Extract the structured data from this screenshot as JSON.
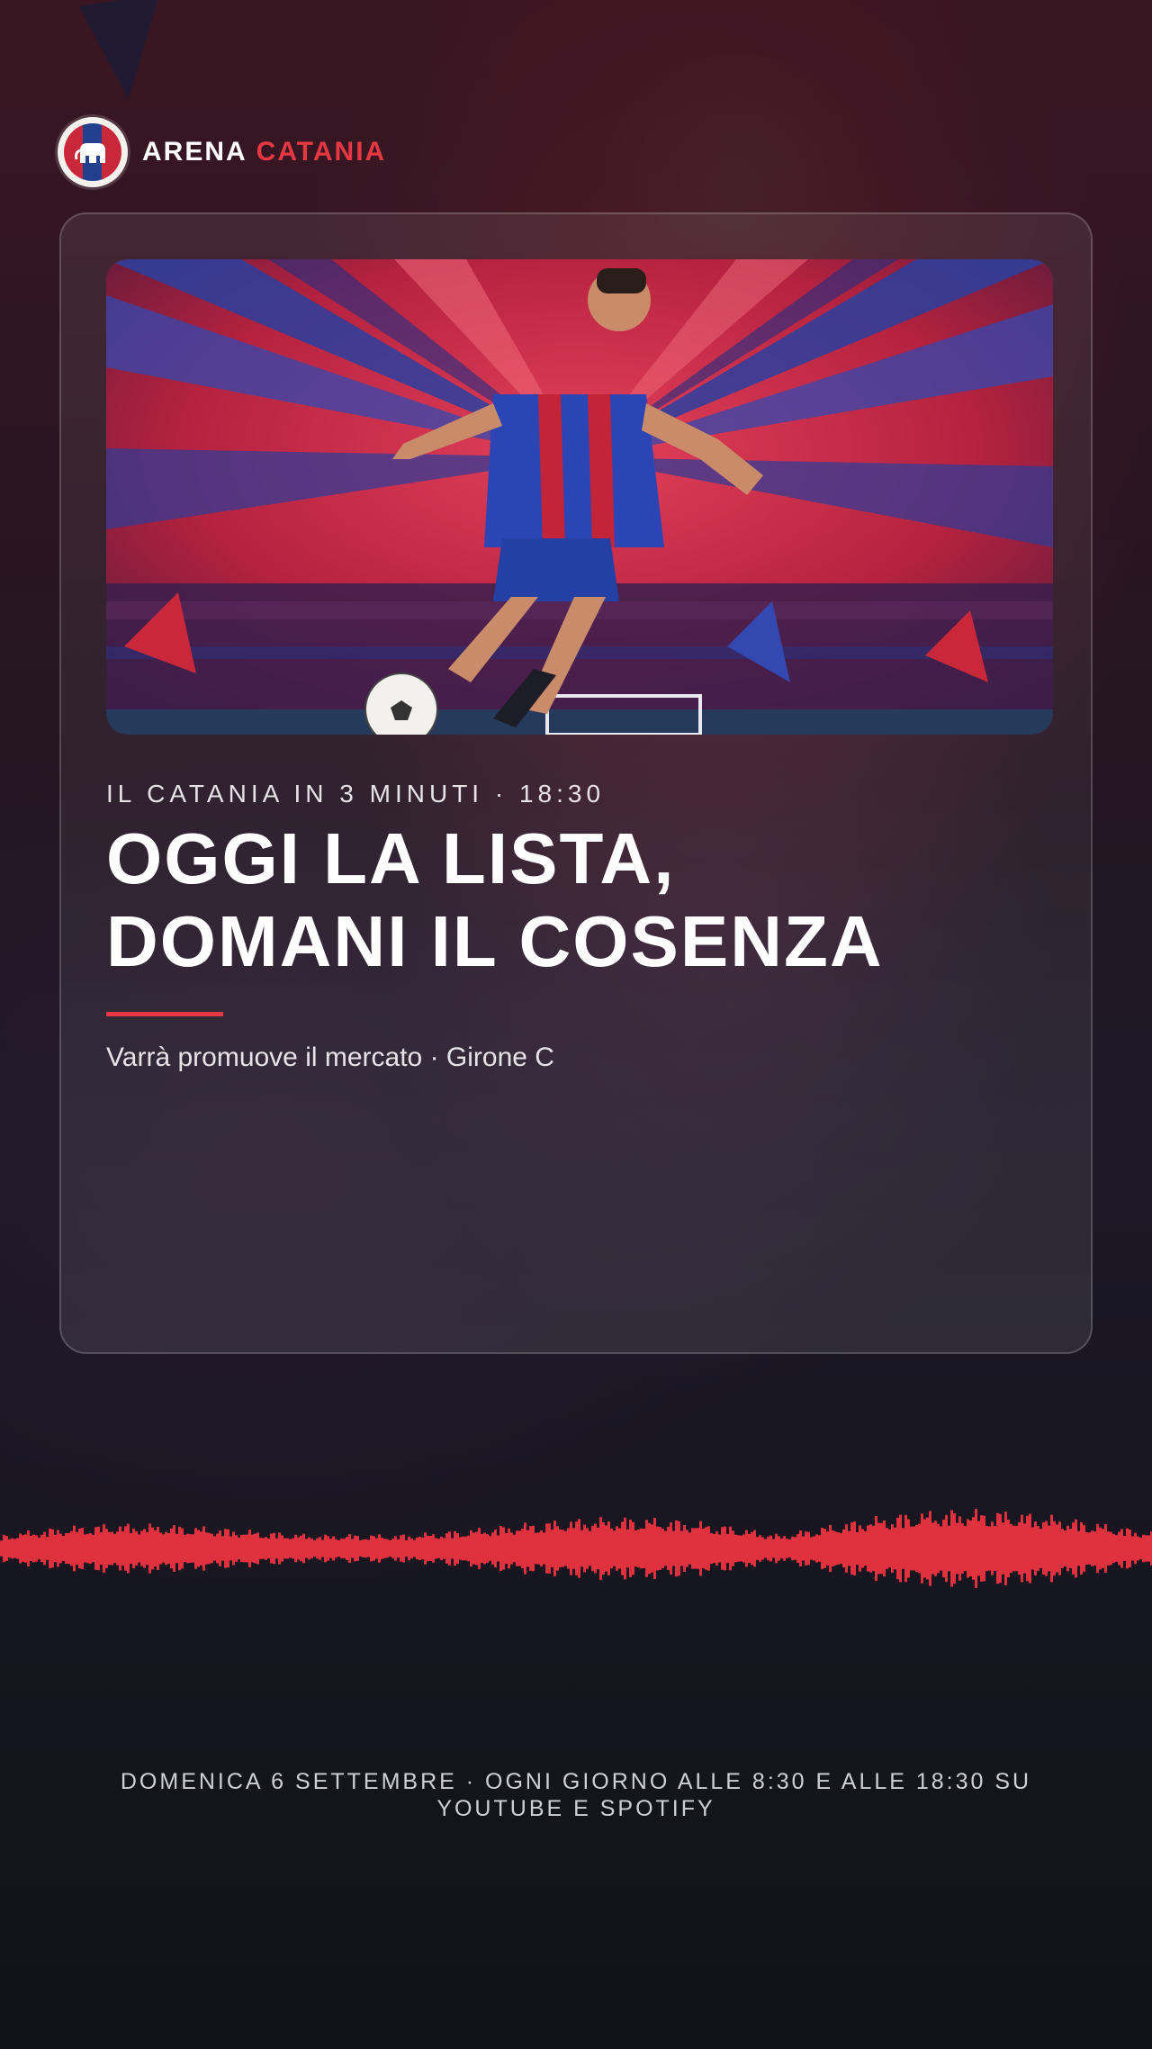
{
  "brand": {
    "name_primary": "ARENA",
    "name_accent": "CATANIA",
    "accent_color": "#e53842"
  },
  "card": {
    "kicker": "IL CATANIA IN 3 MINUTI · 18:30",
    "title_line_1": "OGGI LA LISTA,",
    "title_line_2": "DOMANI IL COSENZA",
    "subtitle": "Varrà promuove il mercato · Girone C"
  },
  "footer": {
    "line_1": "DOMENICA 6 SETTEMBRE · OGNI GIORNO ALLE 8:30 E ALLE 18:30 SU",
    "line_2": "YOUTUBE E SPOTIFY"
  },
  "icons": {
    "logo": "club-crest-icon",
    "audio": "audio-waveform",
    "ball": "soccer-ball-icon"
  },
  "colors": {
    "background": "#14131c",
    "waveform": "#e0313f"
  }
}
